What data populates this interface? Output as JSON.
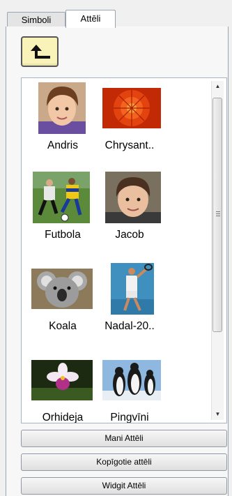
{
  "tabs": [
    {
      "label": "Simboli"
    },
    {
      "label": "Attēli"
    }
  ],
  "up_button": {
    "icon": "folder-up-icon"
  },
  "images": [
    {
      "label": "Andris",
      "icon": "boy-portrait-thumbnail"
    },
    {
      "label": "Chrysant..",
      "icon": "red-flower-thumbnail"
    },
    {
      "label": "Futbola",
      "icon": "football-players-thumbnail"
    },
    {
      "label": "Jacob",
      "icon": "boy-portrait-thumbnail"
    },
    {
      "label": "Koala",
      "icon": "koala-thumbnail"
    },
    {
      "label": "Nadal-20..",
      "icon": "tennis-player-thumbnail"
    },
    {
      "label": "Orhideja",
      "icon": "orchid-thumbnail"
    },
    {
      "label": "Pingvīni",
      "icon": "penguins-thumbnail"
    }
  ],
  "buttons": [
    {
      "label": "Mani Attēli"
    },
    {
      "label": "Kopīgotie attēli"
    },
    {
      "label": "Widgit Attēli"
    }
  ],
  "colors": {
    "up_button_fill": "#faf3b9",
    "list_bg": "#ffffff"
  }
}
